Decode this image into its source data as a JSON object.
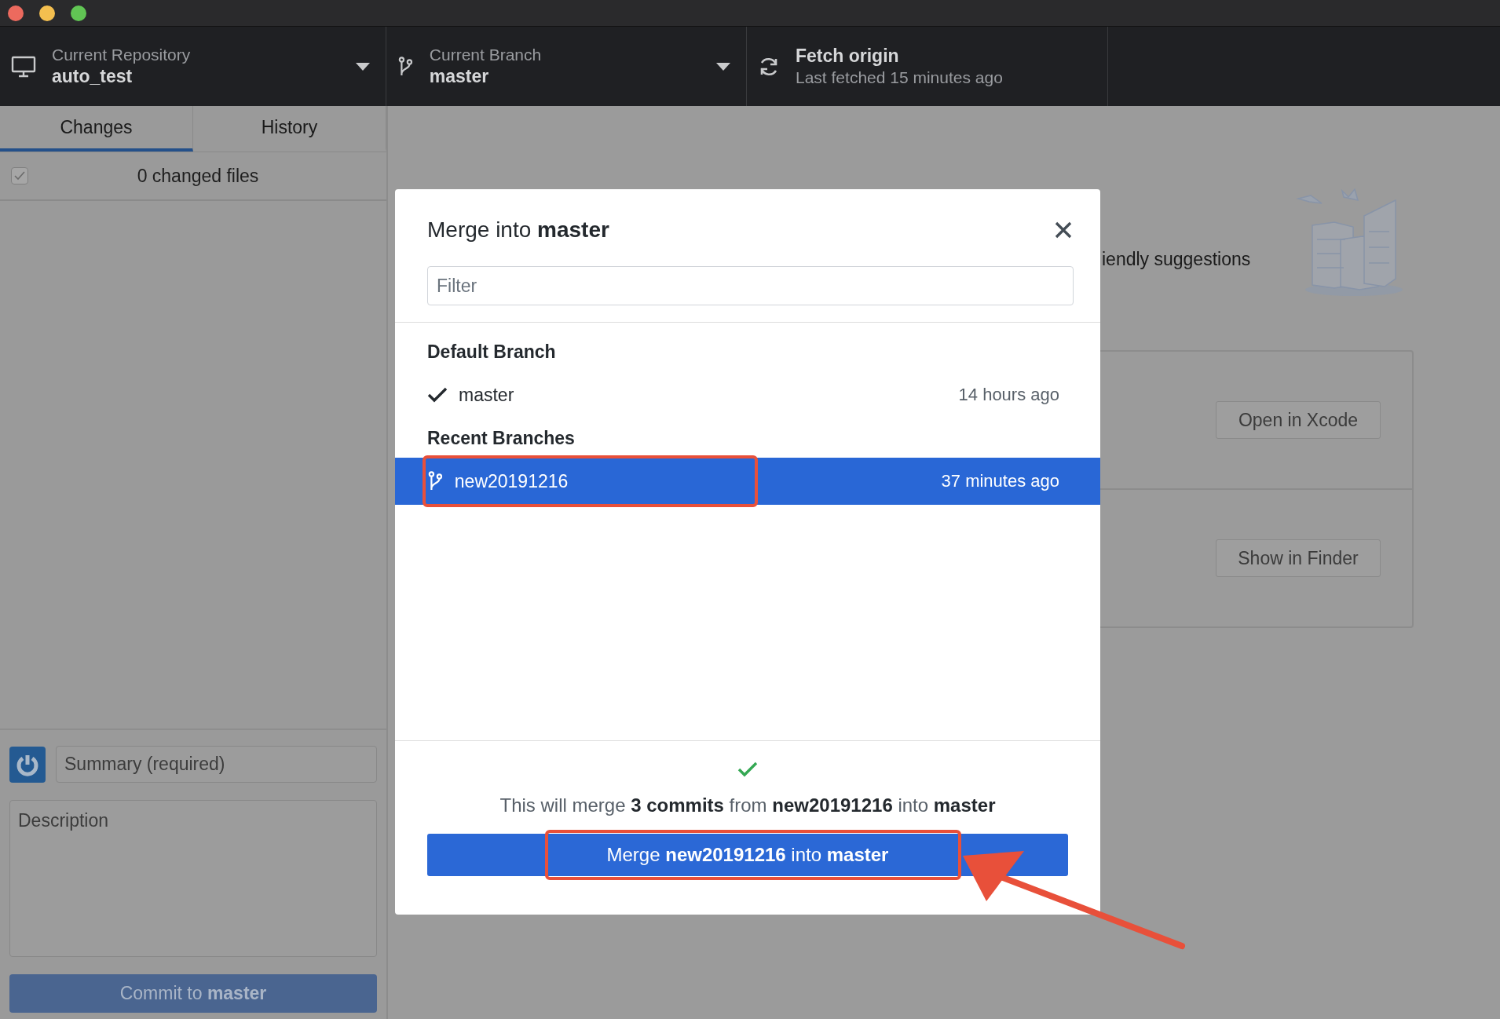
{
  "window": {
    "controls": [
      {
        "color": "#ec6a5e"
      },
      {
        "color": "#f4bf4f"
      },
      {
        "color": "#61c554"
      }
    ]
  },
  "toolbar": {
    "repository": {
      "label": "Current Repository",
      "value": "auto_test"
    },
    "branch": {
      "label": "Current Branch",
      "value": "master"
    },
    "fetch": {
      "label": "Fetch origin",
      "status": "Last fetched 15 minutes ago"
    }
  },
  "sidebar": {
    "tabs": [
      {
        "label": "Changes",
        "selected": true
      },
      {
        "label": "History",
        "selected": false
      }
    ],
    "changes": {
      "checked": true,
      "label": "0 changed files"
    },
    "commit": {
      "summary_placeholder": "Summary (required)",
      "description_placeholder": "Description",
      "button": "Commit to **master**"
    }
  },
  "main": {
    "suggestions_text": "iendly suggestions",
    "buttons": [
      "Open in Xcode",
      "Show in Finder"
    ]
  },
  "dialog": {
    "title": "Merge into **master**",
    "filter_placeholder": "Filter",
    "groups": [
      {
        "heading": "Default Branch",
        "branches": [
          {
            "name": "master",
            "time": "14 hours ago",
            "current": true,
            "selected": false,
            "highlighted": false
          }
        ]
      },
      {
        "heading": "Recent Branches",
        "branches": [
          {
            "name": "new20191216",
            "time": "37 minutes ago",
            "current": false,
            "selected": true,
            "highlighted": true
          }
        ]
      }
    ],
    "summary": "This will merge **3 commits** from **new20191216** into **master**",
    "merge_button": {
      "label": "Merge **new20191216** into **master**",
      "highlighted": true
    },
    "annotation_arrow": true
  }
}
